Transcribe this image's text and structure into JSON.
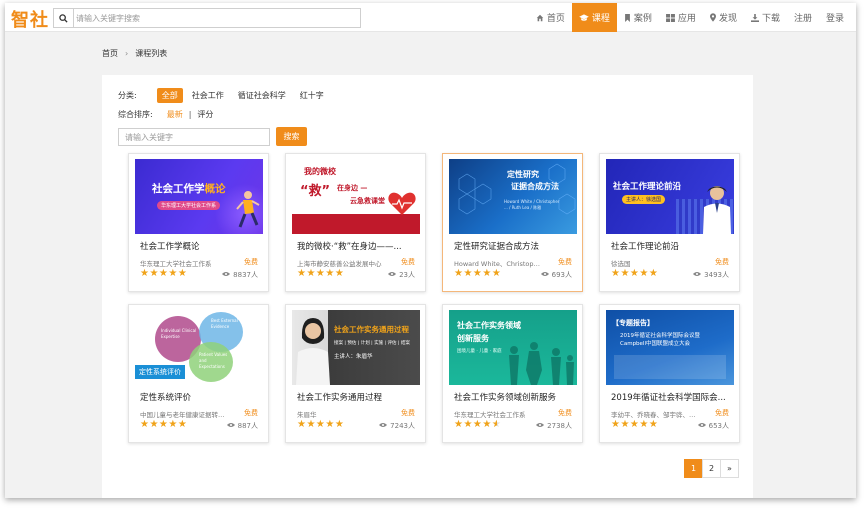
{
  "header": {
    "logo": "智社",
    "search_placeholder": "请输入关键字搜索",
    "nav": [
      {
        "label": "首页",
        "icon": "home-icon",
        "active": false
      },
      {
        "label": "课程",
        "icon": "graduation-cap-icon",
        "active": true
      },
      {
        "label": "案例",
        "icon": "bookmark-icon",
        "active": false
      },
      {
        "label": "应用",
        "icon": "grid-icon",
        "active": false
      },
      {
        "label": "发现",
        "icon": "map-pin-icon",
        "active": false
      },
      {
        "label": "下载",
        "icon": "download-icon",
        "active": false
      },
      {
        "label": "注册",
        "icon": "",
        "active": false
      },
      {
        "label": "登录",
        "icon": "",
        "active": false
      }
    ]
  },
  "breadcrumb": {
    "home": "首页",
    "separator": "›",
    "current": "课程列表"
  },
  "filters": {
    "category_label": "分类:",
    "categories": [
      {
        "label": "全部",
        "active": true
      },
      {
        "label": "社会工作",
        "active": false
      },
      {
        "label": "循证社会科学",
        "active": false
      },
      {
        "label": "红十字",
        "active": false
      }
    ],
    "sort_label": "综合排序:",
    "sort_options": [
      "最新",
      "评分"
    ],
    "sort_separator": "|",
    "keyword_placeholder": "请输入关键字",
    "search_button": "搜索"
  },
  "courses": [
    {
      "title": "社会工作学概论",
      "org": "华东理工大学社会工作系",
      "price": "免费",
      "rating": 5,
      "views": "8837人",
      "thumb": {
        "bg": "#3b2bd1",
        "main": "社会工作学",
        "accent": "概论",
        "sub": "华东理工大学社会工作系"
      }
    },
    {
      "title": "我的微校·“救”在身边——...",
      "org": "上海市静安慈善公益发展中心",
      "price": "免费",
      "rating": 5,
      "views": "23人",
      "thumb": {
        "bg": "#ffffff",
        "main": "我的微校",
        "accent": "“救”",
        "sub": "在身边 —",
        "sub2": "云急救课堂"
      }
    },
    {
      "title": "定性研究证据合成方法",
      "org": "Howard White、Christopher...",
      "price": "免费",
      "rating": 5,
      "views": "693人",
      "thumb": {
        "bg": "#1a5fb4",
        "main": "定性研究",
        "sub": "证据合成方法",
        "names": "Howard White / Christopher ... / Ruth Lea / 陈雅"
      }
    },
    {
      "title": "社会工作理论前沿",
      "org": "徐选国",
      "price": "免费",
      "rating": 5,
      "views": "3493人",
      "thumb": {
        "bg": "#2b2fc7",
        "main": "社会工作理论前沿",
        "sub": "主讲人：徐选国"
      }
    },
    {
      "title": "定性系统评价",
      "org": "中国儿童与老年健康证据转化...",
      "price": "免费",
      "rating": 5,
      "views": "887人",
      "thumb": {
        "bg": "#ffffff",
        "tag": "定性系统评价",
        "c1": "Individual Clinical Expertise",
        "c2": "Best External Evidence",
        "c3": "Patient Values and Expectations"
      }
    },
    {
      "title": "社会工作实务通用过程",
      "org": "朱眉华",
      "price": "免费",
      "rating": 5,
      "views": "7243人",
      "thumb": {
        "bg": "#4a4a4a",
        "main": "社会工作实务通用过程",
        "steps": "接案 | 预估 | 计划 | 实施 | 评估 | 结案",
        "sub": "主讲人：朱眉华"
      }
    },
    {
      "title": "社会工作实务领域创新服务",
      "org": "华东理工大学社会工作系",
      "price": "免费",
      "rating": 4.5,
      "views": "2738人",
      "thumb": {
        "bg": "#17a388",
        "main": "社会工作实务领域",
        "accent": "创新服务",
        "tags": "困境儿童 · 儿童 · 家庭"
      }
    },
    {
      "title": "2019年循证社会科学国际会...",
      "org": "李幼平、乔晓春、邹宇骅、李...",
      "price": "免费",
      "rating": 5,
      "views": "653人",
      "thumb": {
        "bg": "#1e63b8",
        "tag": "【专题报告】",
        "main": "2019年循证社会科学国际会议暨Campbell中国联盟成立大会"
      }
    }
  ],
  "pagination": {
    "pages": [
      "1",
      "2"
    ],
    "current": "1",
    "next": "»"
  },
  "colors": {
    "accent": "#f08c1a",
    "star": "#f0a31a"
  }
}
